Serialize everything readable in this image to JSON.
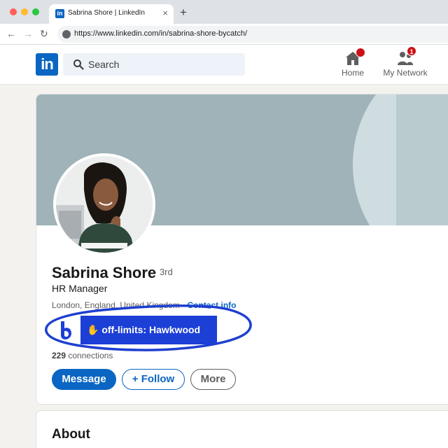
{
  "browser": {
    "tab_title": "Sabrina Shore | LinkedIn",
    "tab_close": "×",
    "new_tab": "+",
    "url": "https://www.linkedin.com/in/sabrina-shore-bycatch/",
    "back": "←",
    "forward": "→",
    "reload": "↻"
  },
  "header": {
    "logo_text": "in",
    "search_placeholder": "Search",
    "nav": {
      "home_label": "Home",
      "network_label": "My Network",
      "network_badge": "1"
    }
  },
  "profile": {
    "name": "Sabrina Shore",
    "degree": "· 3rd",
    "headline": "HR Manager",
    "location": "London, England, United Kingdom ·",
    "contact_info": "Contact info",
    "offlimits_tag": "✋ off-limits: Hawkwood",
    "connections_count": "229",
    "connections_label": "connections",
    "buttons": {
      "message": "Message",
      "follow": "+ Follow",
      "more": "More"
    }
  },
  "about": {
    "title": "About"
  },
  "colors": {
    "linkedin_blue": "#0a66c2",
    "offlimits_blue": "#1c3fd6",
    "annotation_circle": "#1e3fd0",
    "notification_red": "#cc1016"
  }
}
